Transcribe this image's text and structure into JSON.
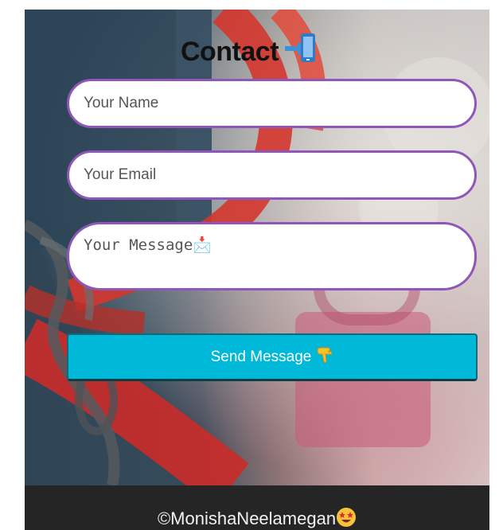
{
  "page": {
    "title": "Contact",
    "title_icon": "mobile-phone-arrow-icon"
  },
  "form": {
    "name_placeholder": "Your Name",
    "email_placeholder": "Your Email",
    "message_placeholder": "Your Message📩",
    "message_icon": "inbox-tray-icon",
    "border_color": "#8e57b8",
    "send_label": "Send Message",
    "send_icon": "pointing-down-hand-icon",
    "send_color": "#00b9d8"
  },
  "footer": {
    "text": "©MonishaNeelamegan",
    "emoji": "star-struck-face-icon",
    "background": "#252525"
  }
}
